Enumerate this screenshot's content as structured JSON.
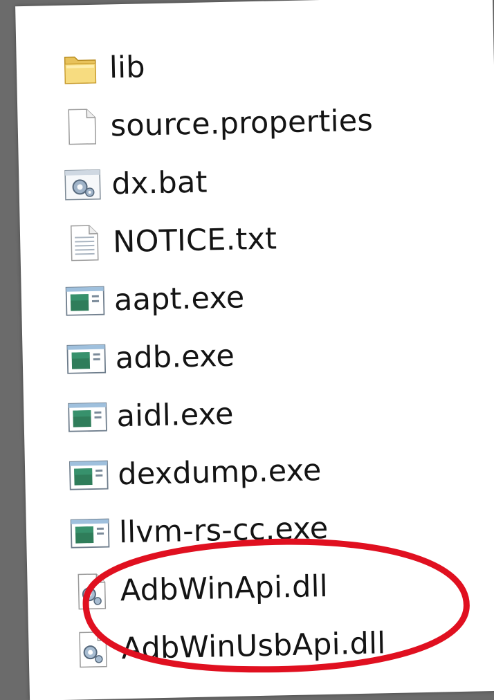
{
  "files": [
    {
      "name": "lib",
      "icon": "folder-icon"
    },
    {
      "name": "source.properties",
      "icon": "blank-file-icon"
    },
    {
      "name": "dx.bat",
      "icon": "batch-file-icon"
    },
    {
      "name": "NOTICE.txt",
      "icon": "text-file-icon"
    },
    {
      "name": "aapt.exe",
      "icon": "exe-file-icon"
    },
    {
      "name": "adb.exe",
      "icon": "exe-file-icon"
    },
    {
      "name": "aidl.exe",
      "icon": "exe-file-icon"
    },
    {
      "name": "dexdump.exe",
      "icon": "exe-file-icon"
    },
    {
      "name": "llvm-rs-cc.exe",
      "icon": "exe-file-icon"
    },
    {
      "name": "AdbWinApi.dll",
      "icon": "dll-file-icon"
    },
    {
      "name": "AdbWinUsbApi.dll",
      "icon": "dll-file-icon"
    }
  ],
  "highlight": {
    "color": "#e01020",
    "items": [
      "AdbWinApi.dll",
      "AdbWinUsbApi.dll"
    ]
  }
}
